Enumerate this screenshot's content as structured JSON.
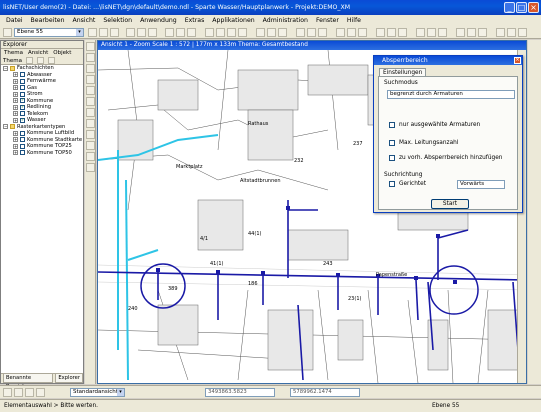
{
  "window": {
    "title": "lisNET/User demo(2) - Datei: ...\\lisNET\\dgn\\default\\demo.ndl - Sparte Wasser/Hauptplanwerk - Projekt:DEMO_XM",
    "min_label": "_",
    "max_label": "□",
    "close_label": "×"
  },
  "menu": [
    "Datei",
    "Bearbeiten",
    "Ansicht",
    "Selektion",
    "Anwendung",
    "Extras",
    "Applikationen",
    "Administration",
    "Fenster",
    "Hilfe"
  ],
  "toolbar": {
    "level_combo": "Ebene 55"
  },
  "explorer": {
    "title": "Explorer",
    "menu": [
      "Thema",
      "Ansicht",
      "Objekt"
    ],
    "sub_label": "Thema",
    "tree": [
      {
        "label": "Fachschichten",
        "level": 0,
        "type": "folder"
      },
      {
        "label": "Abwasser",
        "level": 1,
        "checked": false
      },
      {
        "label": "Fernwärme",
        "level": 1,
        "checked": false
      },
      {
        "label": "Gas",
        "level": 1,
        "checked": false
      },
      {
        "label": "Strom",
        "level": 1,
        "checked": false
      },
      {
        "label": "Kommune",
        "level": 1,
        "checked": true
      },
      {
        "label": "Redlining",
        "level": 1,
        "checked": true
      },
      {
        "label": "Telekom",
        "level": 1,
        "checked": false
      },
      {
        "label": "Wasser",
        "level": 1,
        "checked": true
      },
      {
        "label": "Rasterkartentypen",
        "level": 0,
        "type": "folder"
      },
      {
        "label": "Kommune Luftbild",
        "level": 1,
        "checked": false
      },
      {
        "label": "Kommune Stadtkarte",
        "level": 1,
        "checked": false
      },
      {
        "label": "Kommune TOP25",
        "level": 1,
        "checked": false
      },
      {
        "label": "Kommune TOP50",
        "level": 1,
        "checked": false
      }
    ],
    "tabs": [
      "Benannte Bereiche",
      "Explorer"
    ]
  },
  "map_window": {
    "title": "Ansicht 1 - Zoom Scale 1 : 572 | 177m x 133m Thema: Gesamtbestand",
    "labels": [
      {
        "text": "Marktplatz"
      },
      {
        "text": "Rathaus"
      },
      {
        "text": "Altstadtbrunnen"
      },
      {
        "text": "Papenstraße"
      },
      {
        "text": "232"
      },
      {
        "text": "237"
      },
      {
        "text": "240"
      },
      {
        "text": "186"
      },
      {
        "text": "243"
      },
      {
        "text": "389"
      },
      {
        "text": "4/1"
      },
      {
        "text": "41(1)"
      },
      {
        "text": "44(1)"
      },
      {
        "text": "23(1)"
      }
    ]
  },
  "dialog": {
    "title": "Absperrbereich",
    "tab": "Einstellungen",
    "suchmodus_label": "Suchmodus",
    "suchmodus_value": "begrenzt durch Armaturen",
    "opt1": "nur ausgewählte Armaturen",
    "opt2": "Max. Leitungsanzahl",
    "opt3": "zu vorh. Absperrbereich hinzufügen",
    "suchrichtung_label": "Suchrichtung",
    "gerichtet_label": "Gerichtet",
    "richtung_value": "Vorwärts",
    "start_label": "Start"
  },
  "bottombar": {
    "view_combo": "Standardansicht",
    "x_coord": "3493863.5823",
    "y_coord": "5789962.1474",
    "level": "Ebene 55"
  },
  "status": {
    "text": "Elementauswahl > Bitte werten."
  },
  "colors": {
    "titlebar": "#0a4bd6",
    "pipe_main": "#1a1aa6",
    "pipe_cyan": "#2ec4e6",
    "building_fill": "#e8e8e8"
  }
}
